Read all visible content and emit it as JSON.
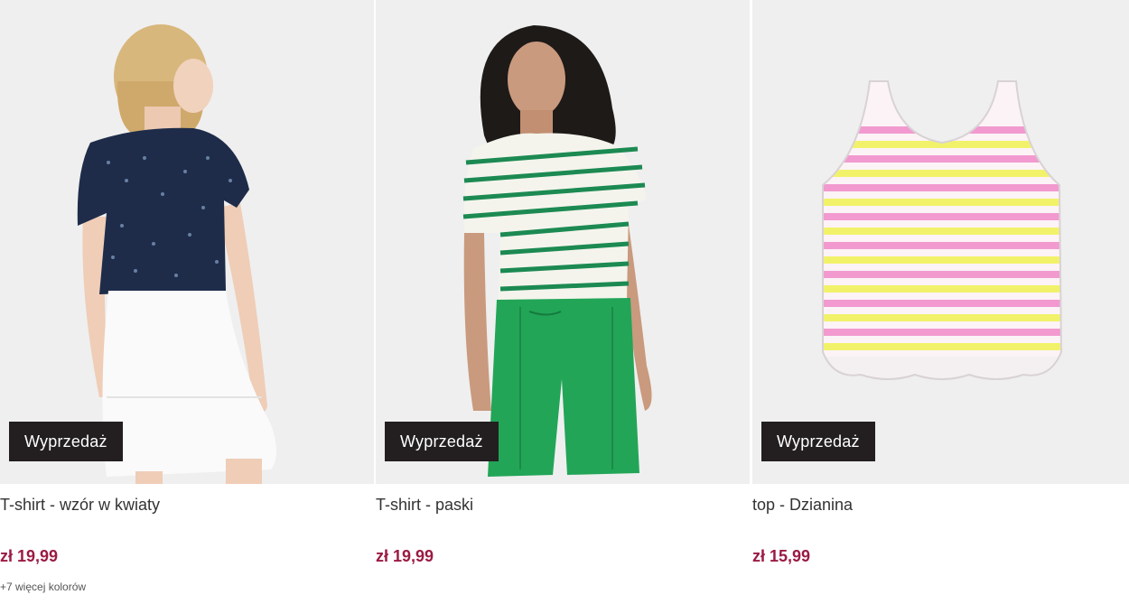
{
  "products": [
    {
      "badge": "Wyprzedaż",
      "title": "T-shirt - wzór w kwiaty",
      "price": "zł 19,99",
      "more_colors": "+7 więcej kolorów"
    },
    {
      "badge": "Wyprzedaż",
      "title": "T-shirt - paski",
      "price": "zł 19,99"
    },
    {
      "badge": "Wyprzedaż",
      "title": "top - Dzianina",
      "price": "zł 15,99"
    }
  ],
  "colors": {
    "badge_bg": "#231f20",
    "price": "#9b1b43",
    "image_bg": "#efefef"
  }
}
